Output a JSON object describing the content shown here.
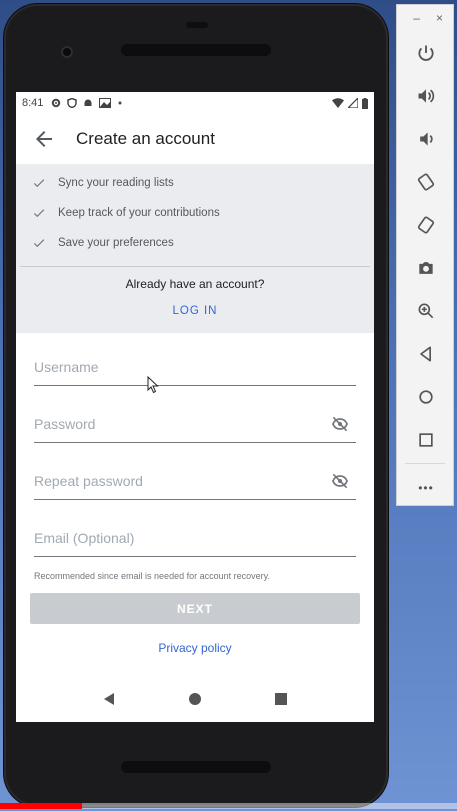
{
  "status_bar": {
    "time": "8:41",
    "icons": [
      "settings-icon",
      "shield-icon",
      "android-icon",
      "image-icon",
      "dot-icon"
    ],
    "right_icons": [
      "wifi-icon",
      "signal-icon",
      "battery-icon"
    ]
  },
  "app_bar": {
    "title": "Create an account",
    "back_icon": "arrow-back-icon"
  },
  "benefits": {
    "items": [
      "Sync your reading lists",
      "Keep track of your contributions",
      "Save your preferences"
    ],
    "question": "Already have an account?",
    "login_label": "LOG IN"
  },
  "form": {
    "username_placeholder": "Username",
    "password_placeholder": "Password",
    "repeat_password_placeholder": "Repeat password",
    "email_placeholder": "Email (Optional)",
    "email_help": "Recommended since email is needed for account recovery.",
    "next_label": "NEXT",
    "privacy_label": "Privacy policy"
  },
  "nav_bar": {
    "buttons": [
      "back-triangle-icon",
      "home-circle-icon",
      "recents-square-icon"
    ]
  },
  "emulator_toolbar": {
    "minimize": "–",
    "close": "×",
    "buttons": [
      "power-icon",
      "volume-up-icon",
      "volume-down-icon",
      "rotate-left-icon",
      "rotate-right-icon",
      "camera-icon",
      "zoom-icon",
      "back-icon",
      "home-icon",
      "overview-icon",
      "more-icon"
    ],
    "more_label": "•••"
  },
  "video": {
    "progress": 0.18
  },
  "colors": {
    "accent": "#3366cc",
    "disabled_button": "#c8ccd1",
    "benefits_bg": "#eaecf0",
    "progress": "#ff0000"
  }
}
